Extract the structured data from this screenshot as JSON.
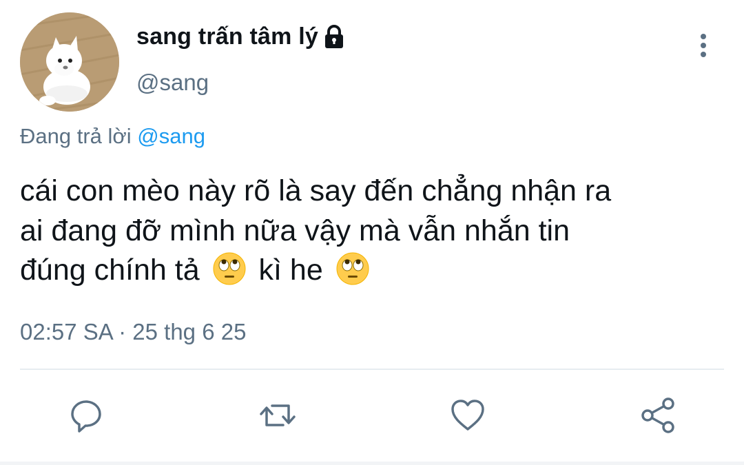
{
  "author": {
    "display_name": "sang trấn tâm lý",
    "handle": "@sang",
    "protected_icon": "lock-icon",
    "avatar": "white-puppy-avatar"
  },
  "reply": {
    "prefix": "Đang trả lời",
    "handle": "@sang"
  },
  "tweet": {
    "line1": "cái con mèo này rõ là say đến chẳng nhận ra",
    "line2": "ai đang đỡ mình nữa vậy mà vẫn nhắn tin",
    "line3_part1": "đúng chính tả",
    "line3_part2": "kì he",
    "emoji": "face-with-rolling-eyes"
  },
  "timestamp": "02:57 SA · 25 thg 6 25",
  "actions": [
    "reply-icon",
    "retweet-icon",
    "like-icon",
    "share-icon"
  ],
  "colors": {
    "text": "#0f1419",
    "secondary": "#5b7083",
    "link": "#1d9bf0",
    "divider": "#e6ecf0"
  }
}
